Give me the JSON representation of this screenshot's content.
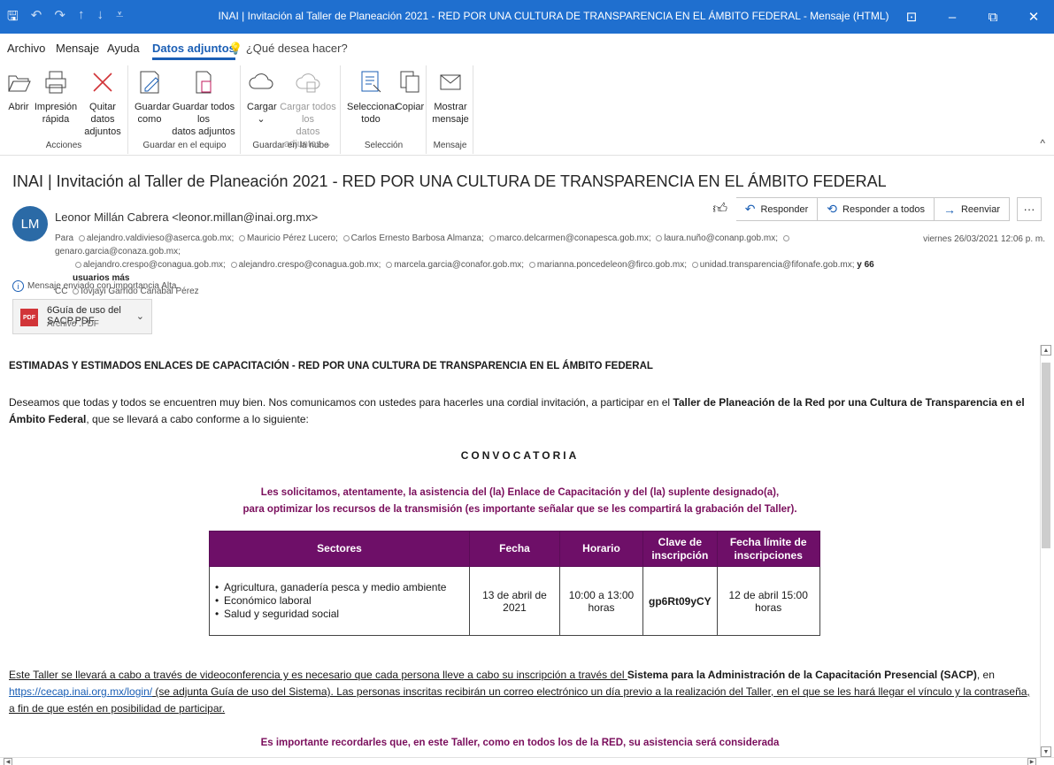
{
  "window": {
    "title": "INAI | Invitación al Taller de Planeación 2021 - RED POR UNA CULTURA DE TRANSPARENCIA EN EL ÁMBITO FEDERAL  -  Mensaje (HTML)"
  },
  "menu": {
    "tabs": [
      "Archivo",
      "Mensaje",
      "Ayuda",
      "Datos adjuntos"
    ],
    "active": "Datos adjuntos",
    "tell_me": "¿Qué desea hacer?"
  },
  "ribbon": {
    "groups": [
      {
        "label": "Acciones",
        "buttons": [
          "Abrir",
          "Impresión rápida",
          "Quitar datos adjuntos"
        ]
      },
      {
        "label": "Guardar en el equipo",
        "buttons": [
          "Guardar como",
          "Guardar todos los datos adjuntos"
        ]
      },
      {
        "label": "Guardar en la nube",
        "buttons": [
          "Cargar",
          "Cargar todos los datos adjuntos"
        ]
      },
      {
        "label": "Selección",
        "buttons": [
          "Seleccionar todo",
          "Copiar"
        ]
      },
      {
        "label": "Mensaje",
        "buttons": [
          "Mostrar mensaje"
        ]
      }
    ],
    "b_abrir": "Abrir",
    "b_impresion_1": "Impresión",
    "b_impresion_2": "rápida",
    "b_quitar_1": "Quitar datos",
    "b_quitar_2": "adjuntos",
    "b_guardar_1": "Guardar",
    "b_guardar_2": "como",
    "b_guardar_todos_1": "Guardar todos los",
    "b_guardar_todos_2": "datos adjuntos",
    "b_cargar": "Cargar",
    "b_cargar_todos_1": "Cargar todos los",
    "b_cargar_todos_2": "datos adjuntos",
    "b_seleccionar_1": "Seleccionar",
    "b_seleccionar_2": "todo",
    "b_copiar": "Copiar",
    "b_mostrar_1": "Mostrar",
    "b_mostrar_2": "mensaje"
  },
  "message": {
    "subject": "INAI | Invitación al Taller de Planeación 2021 - RED POR UNA CULTURA DE TRANSPARENCIA EN EL ÁMBITO FEDERAL",
    "avatar_initials": "LM",
    "sender": "Leonor Millán Cabrera <leonor.millan@inai.org.mx>",
    "to_label": "Para",
    "to_line1": [
      "alejandro.valdivieso@aserca.gob.mx;",
      "Mauricio Pérez Lucero;",
      "Carlos Ernesto Barbosa Almanza;",
      "marco.delcarmen@conapesca.gob.mx;",
      "laura.nuño@conanp.gob.mx;",
      "genaro.garcia@conaza.gob.mx;"
    ],
    "to_line2": [
      "alejandro.crespo@conagua.gob.mx;",
      "alejandro.crespo@conagua.gob.mx;",
      "marcela.garcia@conafor.gob.mx;",
      "marianna.poncedeleon@firco.gob.mx;",
      "unidad.transparencia@fifonafe.gob.mx;"
    ],
    "more": "y 66 usuarios más",
    "cc_label": "CC",
    "cc": "Iovjayi Garrido Canabal Pérez",
    "date": "viernes 26/03/2021 12:06 p. m.",
    "actions": {
      "reply": "Responder",
      "reply_all": "Responder a todos",
      "forward": "Reenviar",
      "more": "···"
    },
    "importance": "Mensaje enviado con importancia Alta.",
    "attachment": {
      "name": "6Guía de uso del SACP.PDF",
      "type": "Archivo .PDF",
      "badge": "PDF"
    }
  },
  "body": {
    "heading": "ESTIMADAS Y ESTIMADOS ENLACES DE CAPACITACIÓN - RED POR UNA CULTURA DE TRANSPARENCIA EN EL ÁMBITO FEDERAL",
    "intro_1": "Deseamos que todas y todos se encuentren muy bien. Nos comunicamos con ustedes para hacerles una cordial invitación, a participar en el ",
    "intro_bold": "Taller de Planeación de la Red por una Cultura de Transparencia en el Ámbito Federal",
    "intro_2": ", que se llevará a cabo conforme a lo siguiente:",
    "convocatoria": "CONVOCATORIA",
    "request_line1": "Les solicitamos, atentamente, la asistencia del (la) Enlace de Capacitación y del (la) suplente designado(a),",
    "request_line2": "para optimizar los recursos de la transmisión (es importante señalar que se les compartirá la grabación del Taller).",
    "table": {
      "headers": [
        "Sectores",
        "Fecha",
        "Horario",
        "Clave de inscripción",
        "Fecha límite de inscripciones"
      ],
      "sectors": [
        "Agricultura, ganadería pesca y medio ambiente",
        "Económico laboral",
        "Salud y seguridad social"
      ],
      "fecha": "13 de abril de 2021",
      "horario": "10:00 a 13:00 horas",
      "clave": "gp6Rt09yCY",
      "limite": "12 de abril 15:00 horas"
    },
    "p2_1": "Este Taller se llevará a cabo a través de videoconferencia y es necesario que cada persona lleve a cabo su inscripción a través del ",
    "p2_bold": "Sistema para la Administración de la Capacitación Presencial (SACP)",
    "p2_2": ", en ",
    "p2_link": "https://cecap.inai.org.mx/login/",
    "p2_3": " (se adjunta Guía de uso del Sistema). Las personas inscritas recibirán un correo electrónico un día previo a la realización del Taller, en el que se les hará llegar el vínculo y la contraseña, a fin de que estén en posibilidad de participar.",
    "final": "Es importante recordarles que, en este Taller, como en todos los de la RED, su asistencia será considerada"
  }
}
